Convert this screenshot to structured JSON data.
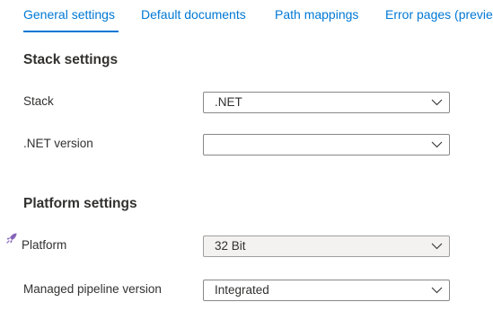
{
  "tabs": [
    {
      "label": "General settings"
    },
    {
      "label": "Default documents"
    },
    {
      "label": "Path mappings"
    },
    {
      "label": "Error pages (preview"
    }
  ],
  "stack_settings": {
    "title": "Stack settings",
    "stack": {
      "label": "Stack",
      "value": ".NET"
    },
    "net_version": {
      "label": ".NET version",
      "value": ""
    }
  },
  "platform_settings": {
    "title": "Platform settings",
    "platform": {
      "label": "Platform",
      "value": "32 Bit"
    },
    "pipeline": {
      "label": "Managed pipeline version",
      "value": "Integrated"
    }
  },
  "icons": {
    "chevron": "chevron-down-icon",
    "rocket": "rocket-icon"
  },
  "colors": {
    "accent": "#0078d4",
    "text": "#323130",
    "disabled_bg": "#f3f2f1",
    "rocket": "#8764b8"
  }
}
